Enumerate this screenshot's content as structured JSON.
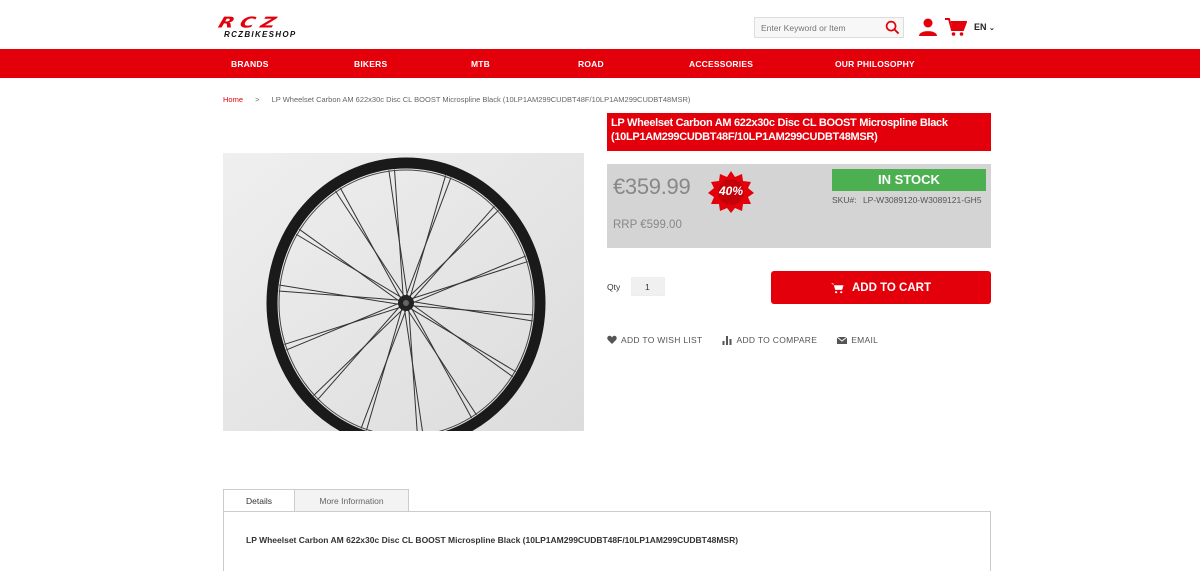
{
  "header": {
    "logo_main": "RCZ",
    "logo_sub": "RCZBIKESHOP",
    "search_placeholder": "Enter Keyword or Item",
    "language": "EN"
  },
  "nav": {
    "items": [
      "BRANDS",
      "BIKERS",
      "MTB",
      "ROAD",
      "ACCESSORIES",
      "OUR PHILOSOPHY"
    ]
  },
  "breadcrumb": {
    "home": "Home",
    "separator": ">",
    "current": "LP Wheelset Carbon AM 622x30c Disc CL BOOST Microspline Black (10LP1AM299CUDBT48F/10LP1AM299CUDBT48MSR)"
  },
  "product": {
    "title": "LP Wheelset Carbon AM 622x30c Disc CL BOOST Microspline Black (10LP1AM299CUDBT48F/10LP1AM299CUDBT48MSR)",
    "price": "€359.99",
    "discount": "40%",
    "rrp": "RRP €599.00",
    "stock_status": "IN STOCK",
    "sku_label": "SKU#:",
    "sku": "LP-W3089120-W3089121-GH5",
    "qty_label": "Qty",
    "qty_value": "1",
    "add_to_cart": "ADD TO CART"
  },
  "actions": {
    "wishlist": "ADD TO WISH LIST",
    "compare": "ADD TO COMPARE",
    "email": "EMAIL"
  },
  "tabs": {
    "details": "Details",
    "more_info": "More Information",
    "details_text": "LP Wheelset Carbon AM 622x30c Disc CL BOOST Microspline Black (10LP1AM299CUDBT48F/10LP1AM299CUDBT48MSR)"
  },
  "colors": {
    "brand_red": "#e4000b",
    "stock_green": "#4caf50",
    "price_box_grey": "#d4d4d4"
  }
}
